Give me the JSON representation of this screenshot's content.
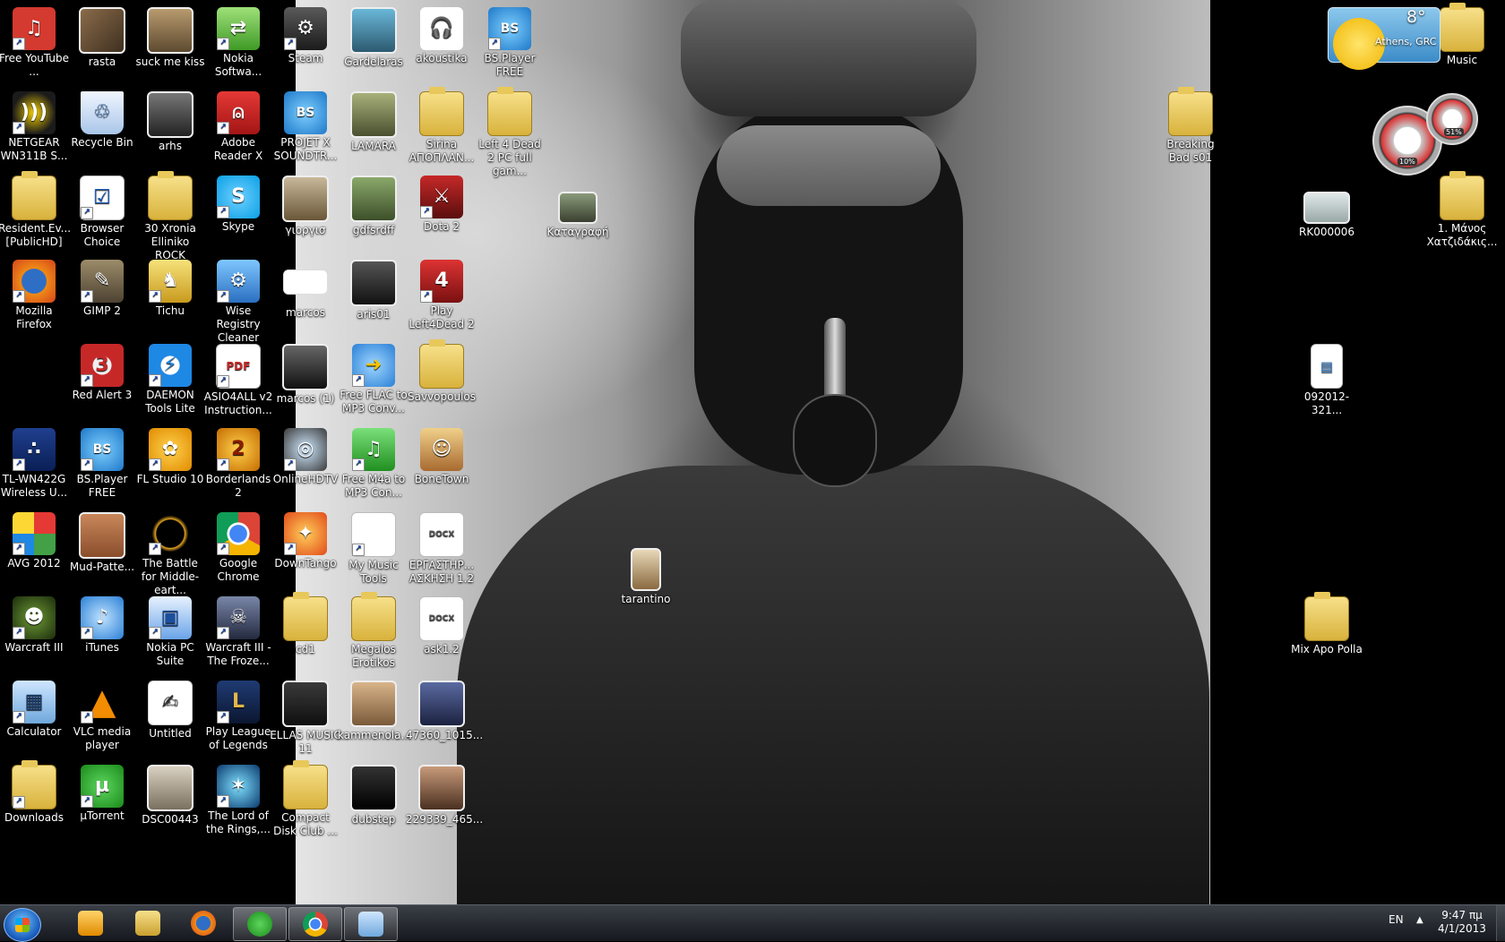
{
  "desktop": {
    "col1": [
      "Free YouTube ...",
      "NETGEAR WN311B S...",
      "Resident.Ev... [PublicHD]",
      "Mozilla Firefox",
      "",
      "TL-WN422G Wireless U...",
      "AVG 2012",
      "Warcraft III",
      "Calculator",
      "Downloads"
    ],
    "col2": [
      "rasta",
      "Recycle Bin",
      "Browser Choice",
      "GIMP 2",
      "Red Alert 3",
      "BS.Player FREE",
      "Mud-Patte...",
      "iTunes",
      "VLC media player",
      "µTorrent"
    ],
    "col3": [
      "suck me kiss",
      "arhs",
      "30 Xronia Elliniko ROCK",
      "Tichu",
      "DAEMON Tools Lite",
      "FL Studio 10",
      "The Battle for Middle-eart...",
      "Nokia PC Suite",
      "Untitled",
      "DSC00443"
    ],
    "col4": [
      "Nokia Softwa...",
      "Adobe Reader X",
      "Skype",
      "Wise Registry Cleaner",
      "ASIO4ALL v2 Instruction...",
      "Borderlands 2",
      "Google Chrome",
      "Warcraft III - The Froze...",
      "Play League of Legends",
      "The Lord of the Rings,..."
    ],
    "col5": [
      "Steam",
      "PROJET X SOUNDTR...",
      "γιοργισ",
      "marcos",
      "marcos (1)",
      "OnlineHDTV",
      "DownTango",
      "cd1",
      "ELLAS MUSIC 11",
      "Compact Disk Club ..."
    ],
    "col6": [
      "Gardelaras",
      "LAMARA",
      "gdfsrdff",
      "aris01",
      "Free FLAC to MP3 Conv...",
      "Free M4a to MP3 Con...",
      "My Music Tools",
      "Megalos Erotikos",
      "kammenola...",
      "dubstep"
    ],
    "col7": [
      "akoustika",
      "Sirina ΑΠΟΠΛΑΝ...",
      "Dota 2",
      "Play Left4Dead 2",
      "Savvopoulos",
      "BoneTown",
      "ΕΡΓΑΣΤΗΡ... ΑΣΚΗΣΗ 1.2",
      "ask1.2",
      "47360_1015...",
      "229339_465..."
    ],
    "col8": [
      "BS.Player FREE",
      "Left 4 Dead 2 PC full gam..."
    ],
    "extra": {
      "katagrafi": "Καταγραφή",
      "tarantino": "tarantino",
      "breaking_bad": "Breaking Bad s01",
      "rk": "RK000006",
      "manos": "1. Μάνος Χατζιδάκις...",
      "file092012": "092012-321...",
      "mix": "Mix Apo Polla",
      "music": "Music"
    }
  },
  "gadgets": {
    "weather_temp": "8°",
    "weather_city": "Athens, GRC",
    "cpu_percent": "10%",
    "mem_percent": "51%"
  },
  "taskbar": {
    "apps": [
      "Windows Media Player",
      "Windows Explorer",
      "Mozilla Firefox",
      "µTorrent",
      "Google Chrome",
      "Paint"
    ],
    "language": "EN",
    "time": "9:47 πμ",
    "date": "4/1/2013"
  }
}
